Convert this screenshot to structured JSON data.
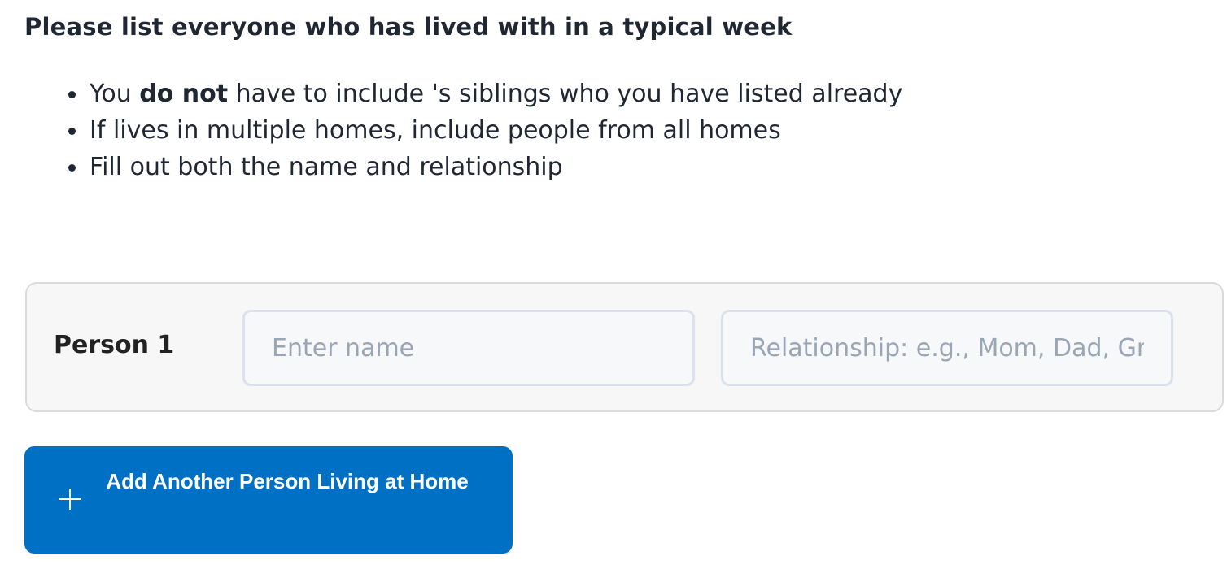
{
  "heading": "Please list everyone who has lived with in a typical week",
  "instructions": {
    "item1": {
      "before": "You ",
      "bold": "do not",
      "after": " have to include 's siblings who you have listed already"
    },
    "item2": "If lives in multiple homes, include people from all homes",
    "item3": "Fill out both the name and relationship"
  },
  "person_card": {
    "label": "Person 1",
    "name_placeholder": "Enter name",
    "relationship_placeholder": "Relationship: e.g., Mom, Dad, Grandparent",
    "name_value": "",
    "relationship_value": ""
  },
  "add_button": {
    "icon": "plus-icon",
    "label": "Add Another Person Living at Home"
  },
  "colors": {
    "button_background": "#0070c4",
    "text": "#1f2733",
    "placeholder": "#9aa6b6",
    "card_background": "#f7f7f8",
    "field_border": "#d8e1ec"
  }
}
